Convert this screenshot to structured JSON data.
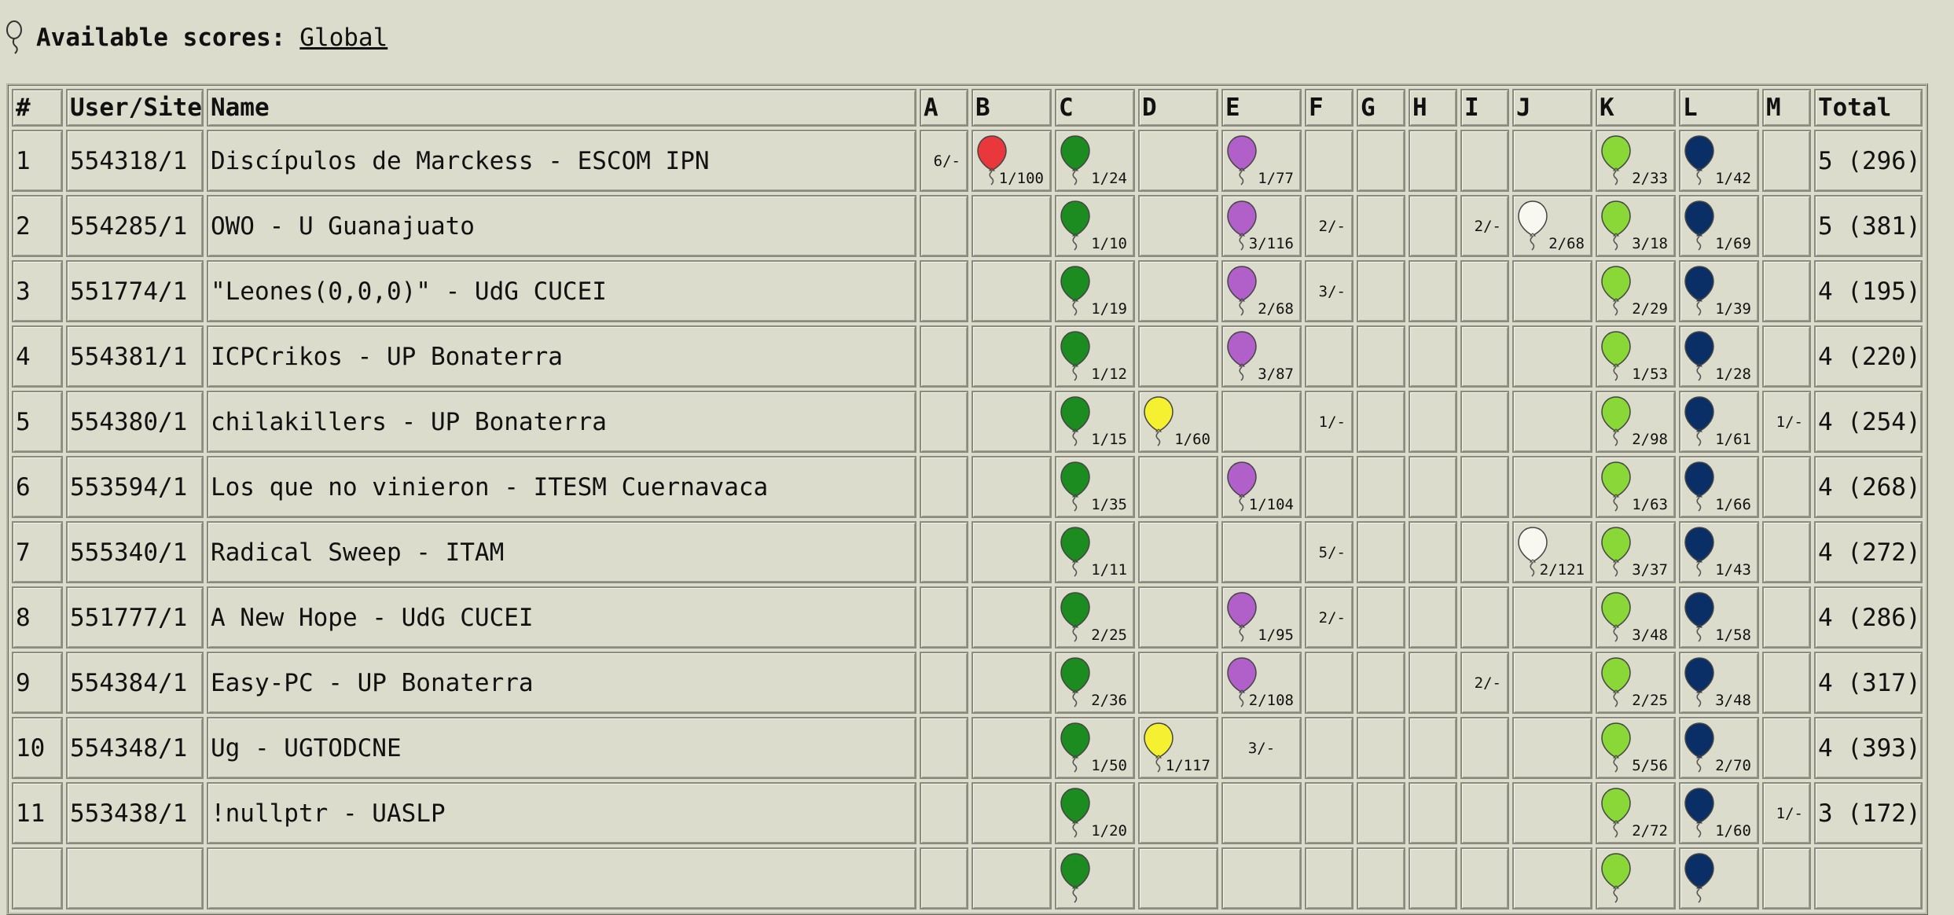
{
  "header": {
    "label": "Available scores:",
    "link": "Global"
  },
  "columns": {
    "rank": "#",
    "user_site": "User/Site",
    "name": "Name",
    "problems": [
      "A",
      "B",
      "C",
      "D",
      "E",
      "F",
      "G",
      "H",
      "I",
      "J",
      "K",
      "L",
      "M"
    ],
    "total": "Total"
  },
  "balloon_colors": {
    "B": "#e8383c",
    "C": "#1d8c20",
    "D": "#f5f030",
    "E": "#b060c8",
    "J": "#f8f8f0",
    "K": "#8ad838",
    "L": "#0a2e66"
  },
  "rows": [
    {
      "rank": "1",
      "user": "554318/1",
      "name": "Discípulos de Marckess - ESCOM IPN",
      "cells": {
        "A": {
          "text": "6/-"
        },
        "B": {
          "solved": true,
          "text": "1/100"
        },
        "C": {
          "solved": true,
          "text": "1/24"
        },
        "E": {
          "solved": true,
          "text": "1/77"
        },
        "K": {
          "solved": true,
          "text": "2/33"
        },
        "L": {
          "solved": true,
          "text": "1/42"
        }
      },
      "total": "5 (296)"
    },
    {
      "rank": "2",
      "user": "554285/1",
      "name": "OWO - U Guanajuato",
      "cells": {
        "C": {
          "solved": true,
          "text": "1/10"
        },
        "E": {
          "solved": true,
          "text": "3/116"
        },
        "F": {
          "text": "2/-"
        },
        "I": {
          "text": "2/-"
        },
        "J": {
          "solved": true,
          "text": "2/68"
        },
        "K": {
          "solved": true,
          "text": "3/18"
        },
        "L": {
          "solved": true,
          "text": "1/69"
        }
      },
      "total": "5 (381)"
    },
    {
      "rank": "3",
      "user": "551774/1",
      "name": "\"Leones(0,0,0)\" - UdG CUCEI",
      "cells": {
        "C": {
          "solved": true,
          "text": "1/19"
        },
        "E": {
          "solved": true,
          "text": "2/68"
        },
        "F": {
          "text": "3/-"
        },
        "K": {
          "solved": true,
          "text": "2/29"
        },
        "L": {
          "solved": true,
          "text": "1/39"
        }
      },
      "total": "4 (195)"
    },
    {
      "rank": "4",
      "user": "554381/1",
      "name": "ICPCrikos - UP Bonaterra",
      "cells": {
        "C": {
          "solved": true,
          "text": "1/12"
        },
        "E": {
          "solved": true,
          "text": "3/87"
        },
        "K": {
          "solved": true,
          "text": "1/53"
        },
        "L": {
          "solved": true,
          "text": "1/28"
        }
      },
      "total": "4 (220)"
    },
    {
      "rank": "5",
      "user": "554380/1",
      "name": "chilakillers - UP Bonaterra",
      "cells": {
        "C": {
          "solved": true,
          "text": "1/15"
        },
        "D": {
          "solved": true,
          "text": "1/60"
        },
        "F": {
          "text": "1/-"
        },
        "K": {
          "solved": true,
          "text": "2/98"
        },
        "L": {
          "solved": true,
          "text": "1/61"
        },
        "M": {
          "text": "1/-"
        }
      },
      "total": "4 (254)"
    },
    {
      "rank": "6",
      "user": "553594/1",
      "name": "Los que no vinieron - ITESM Cuernavaca",
      "cells": {
        "C": {
          "solved": true,
          "text": "1/35"
        },
        "E": {
          "solved": true,
          "text": "1/104"
        },
        "K": {
          "solved": true,
          "text": "1/63"
        },
        "L": {
          "solved": true,
          "text": "1/66"
        }
      },
      "total": "4 (268)"
    },
    {
      "rank": "7",
      "user": "555340/1",
      "name": "Radical Sweep - ITAM",
      "cells": {
        "C": {
          "solved": true,
          "text": "1/11"
        },
        "F": {
          "text": "5/-"
        },
        "J": {
          "solved": true,
          "text": "2/121"
        },
        "K": {
          "solved": true,
          "text": "3/37"
        },
        "L": {
          "solved": true,
          "text": "1/43"
        }
      },
      "total": "4 (272)"
    },
    {
      "rank": "8",
      "user": "551777/1",
      "name": "A New Hope - UdG CUCEI",
      "cells": {
        "C": {
          "solved": true,
          "text": "2/25"
        },
        "E": {
          "solved": true,
          "text": "1/95"
        },
        "F": {
          "text": "2/-"
        },
        "K": {
          "solved": true,
          "text": "3/48"
        },
        "L": {
          "solved": true,
          "text": "1/58"
        }
      },
      "total": "4 (286)"
    },
    {
      "rank": "9",
      "user": "554384/1",
      "name": "Easy-PC - UP Bonaterra",
      "cells": {
        "C": {
          "solved": true,
          "text": "2/36"
        },
        "E": {
          "solved": true,
          "text": "2/108"
        },
        "I": {
          "text": "2/-"
        },
        "K": {
          "solved": true,
          "text": "2/25"
        },
        "L": {
          "solved": true,
          "text": "3/48"
        }
      },
      "total": "4 (317)"
    },
    {
      "rank": "10",
      "user": "554348/1",
      "name": "Ug - UGTODCNE",
      "cells": {
        "C": {
          "solved": true,
          "text": "1/50"
        },
        "D": {
          "solved": true,
          "text": "1/117"
        },
        "E": {
          "text": "3/-",
          "align": "center"
        },
        "K": {
          "solved": true,
          "text": "5/56"
        },
        "L": {
          "solved": true,
          "text": "2/70"
        }
      },
      "total": "4 (393)"
    },
    {
      "rank": "11",
      "user": "553438/1",
      "name": "!nullptr - UASLP",
      "cells": {
        "C": {
          "solved": true,
          "text": "1/20"
        },
        "K": {
          "solved": true,
          "text": "2/72"
        },
        "L": {
          "solved": true,
          "text": "1/60"
        },
        "M": {
          "text": "1/-"
        }
      },
      "total": "3 (172)"
    },
    {
      "rank": "",
      "user": "",
      "name": "",
      "cells": {
        "C": {
          "solved": true,
          "text": ""
        },
        "K": {
          "solved": true,
          "text": ""
        },
        "L": {
          "solved": true,
          "text": ""
        }
      },
      "total": ""
    }
  ]
}
